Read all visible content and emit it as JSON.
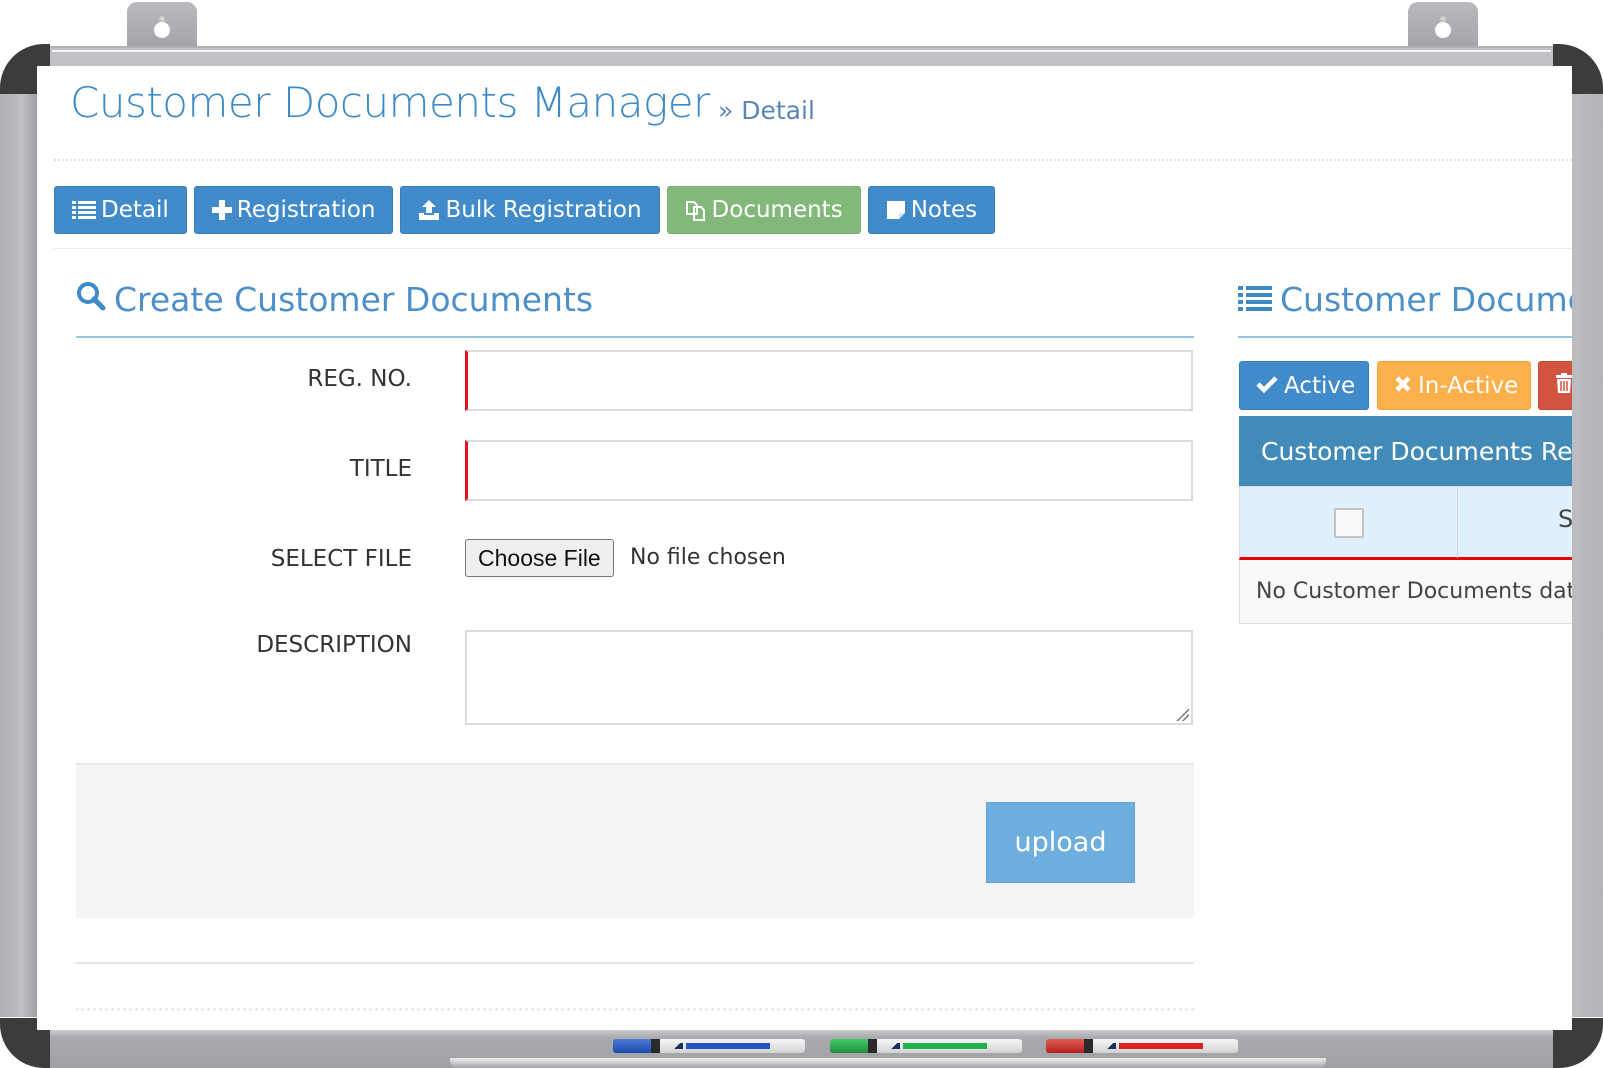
{
  "header": {
    "title": "Customer Documents Manager",
    "breadcrumb": "» Detail"
  },
  "tabs": [
    {
      "label": "Detail",
      "icon": "list-icon",
      "color": "#428bca",
      "active": false
    },
    {
      "label": "Registration",
      "icon": "plus-icon",
      "color": "#428bca",
      "active": false
    },
    {
      "label": "Bulk Registration",
      "icon": "upload-icon",
      "color": "#428bca",
      "active": false
    },
    {
      "label": "Documents",
      "icon": "copy-icon",
      "color": "#82b97a",
      "active": true
    },
    {
      "label": "Notes",
      "icon": "note-icon",
      "color": "#428bca",
      "active": false
    }
  ],
  "create_panel": {
    "title": "Create Customer Documents",
    "icon": "search-icon",
    "fields": {
      "reg_no": {
        "label": "REG. NO.",
        "value": "",
        "required": true
      },
      "title": {
        "label": "TITLE",
        "value": "",
        "required": true
      },
      "file": {
        "label": "SELECT FILE",
        "button_label": "Choose File",
        "status": "No file chosen"
      },
      "description": {
        "label": "DESCRIPTION",
        "value": ""
      }
    },
    "submit_label": "upload"
  },
  "list_panel": {
    "title": "Customer Documents",
    "icon": "list-icon",
    "actions": [
      {
        "label": "Active",
        "icon": "check-icon",
        "color": "#428bca"
      },
      {
        "label": "In-Active",
        "icon": "times-icon",
        "color": "#fcb04b"
      },
      {
        "label": "",
        "icon": "trash-icon",
        "color": "#d2533f"
      }
    ],
    "table": {
      "caption": "Customer Documents Records",
      "columns": [
        "",
        "S"
      ],
      "empty_message": "No Customer Documents data"
    }
  },
  "colors": {
    "primary": "#428bca",
    "success": "#82b97a",
    "warning": "#fcb04b",
    "danger": "#d2533f",
    "title": "#3d8ac6",
    "required_marker": "#e4121e"
  }
}
